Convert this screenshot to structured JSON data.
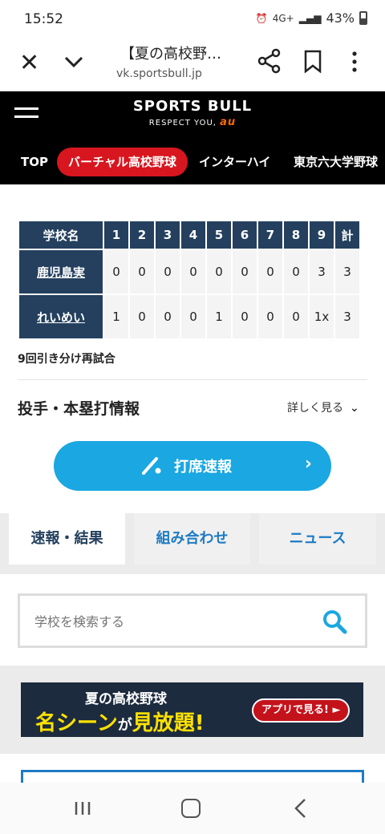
{
  "status_bar": {
    "time": "15:52",
    "network": "4G+",
    "battery": "43%"
  },
  "browser": {
    "page_title": "【夏の高校野…",
    "url": "vk.sportsbull.jp"
  },
  "site": {
    "logo_main": "SPORTS BULL",
    "logo_sub": "RESPECT YOU,",
    "logo_brand": "au",
    "nav": [
      {
        "label": "TOP"
      },
      {
        "label": "バーチャル高校野球"
      },
      {
        "label": "インターハイ"
      },
      {
        "label": "東京六大学野球"
      }
    ]
  },
  "scoreboard": {
    "header": [
      "学校名",
      "1",
      "2",
      "3",
      "4",
      "5",
      "6",
      "7",
      "8",
      "9",
      "計"
    ],
    "rows": [
      {
        "team": "鹿児島実",
        "scores": [
          "0",
          "0",
          "0",
          "0",
          "0",
          "0",
          "0",
          "0",
          "3",
          "3"
        ]
      },
      {
        "team": "れいめい",
        "scores": [
          "1",
          "0",
          "0",
          "0",
          "1",
          "0",
          "0",
          "0",
          "1x",
          "3"
        ]
      }
    ],
    "note": "9回引き分け再試合"
  },
  "pitch_section": {
    "title": "投手・本塁打情報",
    "detail_link": "詳しく見る"
  },
  "cta_button": {
    "label": "打席速報"
  },
  "tabs": [
    {
      "label": "速報・結果",
      "active": true
    },
    {
      "label": "組み合わせ",
      "active": false
    },
    {
      "label": "ニュース",
      "active": false
    }
  ],
  "search": {
    "placeholder": "学校を検索する"
  },
  "banner": {
    "line1": "夏の高校野球",
    "line2_prefix": "名シーン",
    "line2_mid": "が",
    "line2_suffix": "見放題!",
    "button": "アプリで見る! ►"
  },
  "colors": {
    "header_bg": "#000000",
    "active_nav": "#d8161f",
    "table_header": "#24405e",
    "cta": "#1aa7e2",
    "tab_text": "#1e7bc4"
  }
}
